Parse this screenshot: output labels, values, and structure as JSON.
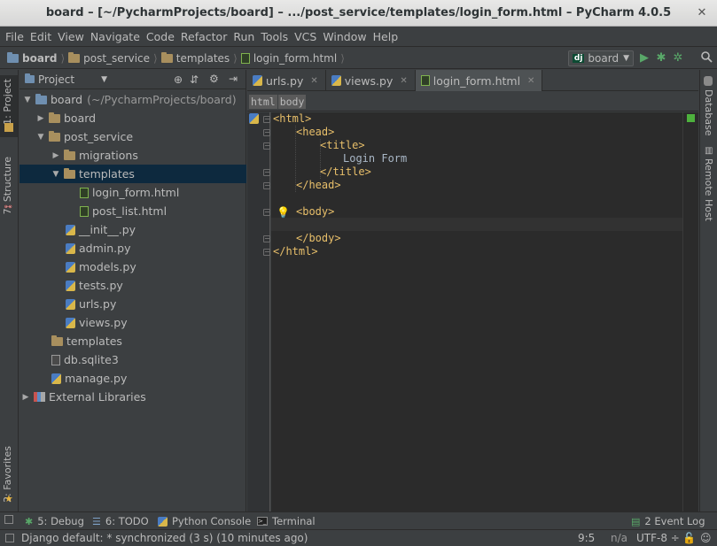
{
  "window": {
    "title": "board – [~/PycharmProjects/board] – .../post_service/templates/login_form.html – PyCharm 4.0.5"
  },
  "menu": [
    "File",
    "Edit",
    "View",
    "Navigate",
    "Code",
    "Refactor",
    "Run",
    "Tools",
    "VCS",
    "Window",
    "Help"
  ],
  "breadcrumbs": [
    "board",
    "post_service",
    "templates",
    "login_form.html"
  ],
  "run_config": {
    "label": "board",
    "badge": "dj"
  },
  "tool_windows": {
    "left": [
      "1: Project",
      "7: Structure",
      "2: Favorites"
    ],
    "right": [
      "Database",
      "Remote Host"
    ]
  },
  "project": {
    "header": "Project",
    "root": {
      "name": "board",
      "path": "(~/PycharmProjects/board)"
    },
    "items": [
      {
        "label": "board",
        "kind": "folder",
        "level": 1,
        "arrow": "collapsed"
      },
      {
        "label": "post_service",
        "kind": "folder",
        "level": 1,
        "arrow": "expanded"
      },
      {
        "label": "migrations",
        "kind": "folder",
        "level": 2,
        "arrow": "collapsed"
      },
      {
        "label": "templates",
        "kind": "folder",
        "level": 2,
        "arrow": "expanded",
        "selected": true
      },
      {
        "label": "login_form.html",
        "kind": "html",
        "level": 3
      },
      {
        "label": "post_list.html",
        "kind": "html",
        "level": 3
      },
      {
        "label": "__init__.py",
        "kind": "py",
        "level": 2
      },
      {
        "label": "admin.py",
        "kind": "py",
        "level": 2
      },
      {
        "label": "models.py",
        "kind": "py",
        "level": 2
      },
      {
        "label": "tests.py",
        "kind": "py",
        "level": 2
      },
      {
        "label": "urls.py",
        "kind": "py",
        "level": 2
      },
      {
        "label": "views.py",
        "kind": "py",
        "level": 2
      },
      {
        "label": "templates",
        "kind": "folder",
        "level": 1
      },
      {
        "label": "db.sqlite3",
        "kind": "db",
        "level": 1
      },
      {
        "label": "manage.py",
        "kind": "py",
        "level": 1
      },
      {
        "label": "External Libraries",
        "kind": "lib",
        "level": 0,
        "arrow": "collapsed"
      }
    ]
  },
  "editor": {
    "tabs": [
      {
        "label": "urls.py",
        "active": false
      },
      {
        "label": "views.py",
        "active": false
      },
      {
        "label": "login_form.html",
        "active": true
      }
    ],
    "tag_breadcrumbs": [
      "html",
      "body"
    ],
    "lines": [
      {
        "indent": 0,
        "text": "<html>",
        "type": "tag"
      },
      {
        "indent": 1,
        "text": "<head>",
        "type": "tag"
      },
      {
        "indent": 2,
        "text": "<title>",
        "type": "tag"
      },
      {
        "indent": 3,
        "text": "Login Form",
        "type": "text"
      },
      {
        "indent": 2,
        "text": "</title>",
        "type": "tag"
      },
      {
        "indent": 1,
        "text": "</head>",
        "type": "tag"
      },
      {
        "indent": 0,
        "text": "",
        "type": "text"
      },
      {
        "indent": 1,
        "text": "<body>",
        "type": "tag"
      },
      {
        "indent": 0,
        "text": "",
        "type": "text"
      },
      {
        "indent": 1,
        "text": "</body>",
        "type": "tag"
      },
      {
        "indent": 0,
        "text": "</html>",
        "type": "tag"
      }
    ]
  },
  "bottom_tools": {
    "debug": "5: Debug",
    "todo": "6: TODO",
    "console": "Python Console",
    "terminal": "Terminal",
    "event_log": "2 Event Log"
  },
  "status": {
    "message": "Django default: * synchronized (3 s) (10 minutes ago)",
    "position": "9:5",
    "na": "n/a",
    "encoding": "UTF-8 ÷"
  },
  "colors": {
    "tag": "#e8bf6a",
    "text": "#a9b7c6",
    "selection": "#0d293e",
    "editor_bg": "#2b2b2b",
    "panel_bg": "#3c3f41"
  }
}
